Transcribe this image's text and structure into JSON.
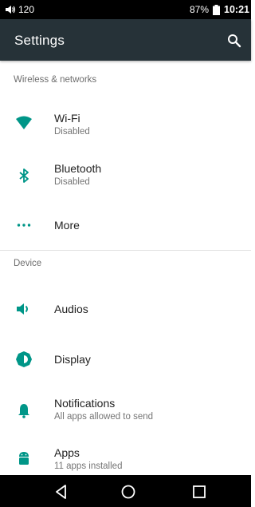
{
  "status_bar": {
    "volume_value": "120",
    "battery_percent": "87%",
    "time": "10:21",
    "icons": [
      "volume-icon",
      "battery-icon"
    ]
  },
  "app_bar": {
    "title": "Settings",
    "search_icon": "search-icon"
  },
  "sections": [
    {
      "header": "Wireless & networks",
      "items": [
        {
          "title": "Wi-Fi",
          "summary": "Disabled",
          "icon": "wifi-icon"
        },
        {
          "title": "Bluetooth",
          "summary": "Disabled",
          "icon": "bluetooth-icon"
        },
        {
          "title": "More",
          "summary": "",
          "icon": "more-icon"
        }
      ]
    },
    {
      "header": "Device",
      "items": [
        {
          "title": "Audios",
          "summary": "",
          "icon": "audio-icon"
        },
        {
          "title": "Display",
          "summary": "",
          "icon": "display-icon"
        },
        {
          "title": "Notifications",
          "summary": "All apps allowed to send",
          "icon": "notifications-icon"
        },
        {
          "title": "Apps",
          "summary": "11 apps installed",
          "icon": "apps-icon"
        }
      ]
    }
  ],
  "nav_bar": {
    "buttons": [
      "back-icon",
      "home-icon",
      "recents-icon"
    ]
  },
  "colors": {
    "accent": "#009688",
    "app_bar": "#263238",
    "status_bar": "#000000",
    "nav_bar": "#000000"
  }
}
